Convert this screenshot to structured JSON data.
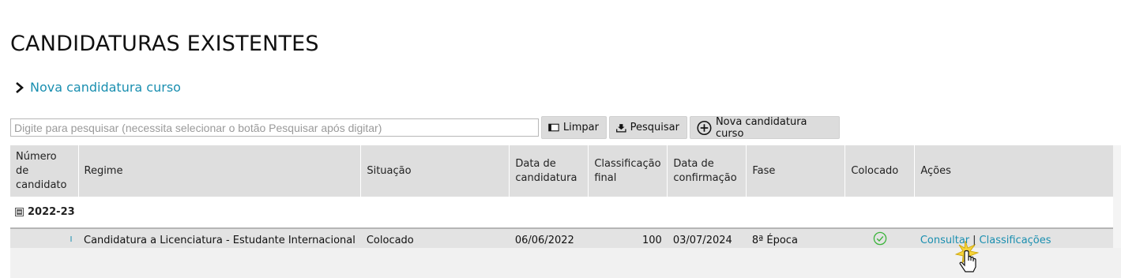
{
  "page": {
    "title": "CANDIDATURAS EXISTENTES"
  },
  "nav": {
    "new_application_link": "Nova candidatura curso",
    "chevron_icon": "chevron-right-icon"
  },
  "toolbar": {
    "search_placeholder": "Digite para pesquisar (necessita selecionar o botão Pesquisar após digitar)",
    "search_value": "",
    "clear_label": "Limpar",
    "search_label": "Pesquisar",
    "new_label": "Nova candidatura curso"
  },
  "table": {
    "headers": {
      "numero": "Número de candidato",
      "regime": "Regime",
      "situacao": "Situação",
      "data_candidatura": "Data de candidatura",
      "classificacao": "Classificação final",
      "data_confirmacao": "Data de confirmação",
      "fase": "Fase",
      "colocado": "Colocado",
      "acoes": "Ações"
    },
    "group": {
      "label": "2022-23",
      "toggle_icon": "collapse-minus-icon"
    },
    "rows": [
      {
        "numero": "",
        "regime": "Candidatura a Licenciatura - Estudante Internacional",
        "situacao": "Colocado",
        "data_candidatura": "06/06/2022",
        "classificacao": "100",
        "data_confirmacao": "03/07/2024",
        "fase": "8ª Época",
        "colocado_icon": "check-circle-icon",
        "action_consultar": "Consultar",
        "action_sep": "|",
        "action_classificacoes": "Classificações"
      }
    ]
  },
  "colors": {
    "link": "#1a8fb0",
    "header_bg": "#dedede",
    "row_bg": "#e3e3e3",
    "check": "#3cb43c"
  }
}
